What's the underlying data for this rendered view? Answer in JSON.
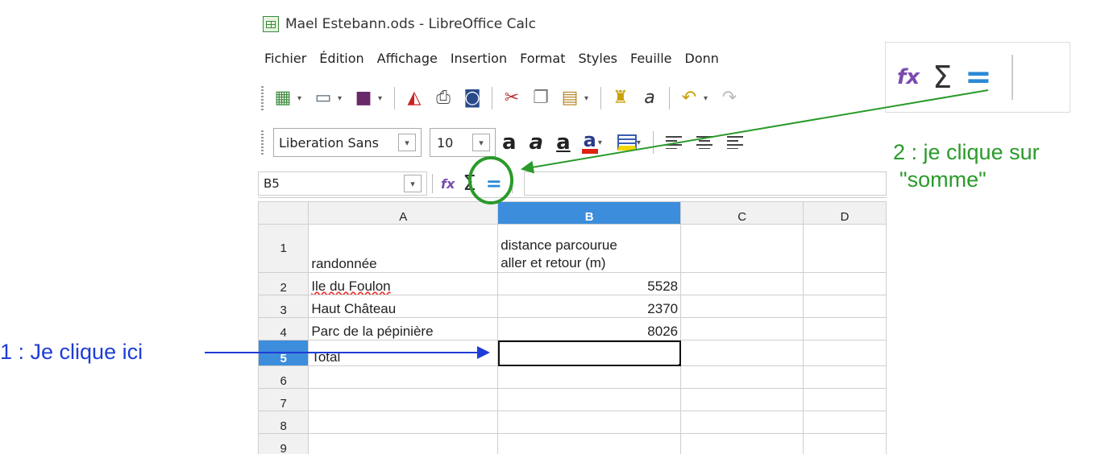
{
  "window": {
    "title": "Mael Estebann.ods - LibreOffice Calc",
    "icon": "calc-icon"
  },
  "menu": {
    "items": [
      {
        "label": "Fichier"
      },
      {
        "label": "Édition"
      },
      {
        "label": "Affichage"
      },
      {
        "label": "Insertion"
      },
      {
        "label": "Format"
      },
      {
        "label": "Styles"
      },
      {
        "label": "Feuille"
      },
      {
        "label": "Donn"
      }
    ]
  },
  "format_toolbar": {
    "font_name": "Liberation Sans",
    "font_size": "10"
  },
  "formula_bar": {
    "name_box": "B5",
    "formula": ""
  },
  "grid": {
    "columns": [
      "A",
      "B",
      "C",
      "D"
    ],
    "selected_column": "B",
    "rows": [
      {
        "num": "1",
        "a": "randonnée",
        "b1": "distance parcourue",
        "b2": "aller et retour (m)"
      },
      {
        "num": "2",
        "a": "Ile du Foulon",
        "b": "5528"
      },
      {
        "num": "3",
        "a": "Haut Château",
        "b": "2370"
      },
      {
        "num": "4",
        "a": "Parc de la pépinière",
        "b": "8026"
      },
      {
        "num": "5",
        "a": "Total",
        "b": ""
      },
      {
        "num": "6"
      },
      {
        "num": "7"
      },
      {
        "num": "8"
      },
      {
        "num": "9"
      }
    ],
    "selected_row": "5",
    "selected_cell": "B5"
  },
  "annotations": {
    "step1": "1 : Je clique ici",
    "step2_line1": "2 : je clique sur",
    "step2_line2": "\"somme\"",
    "step1_color": "#1f3dd6",
    "step2_color": "#2a9a2a"
  },
  "icons": {
    "function_wizard": "fx",
    "sum": "Σ",
    "equal": "="
  }
}
